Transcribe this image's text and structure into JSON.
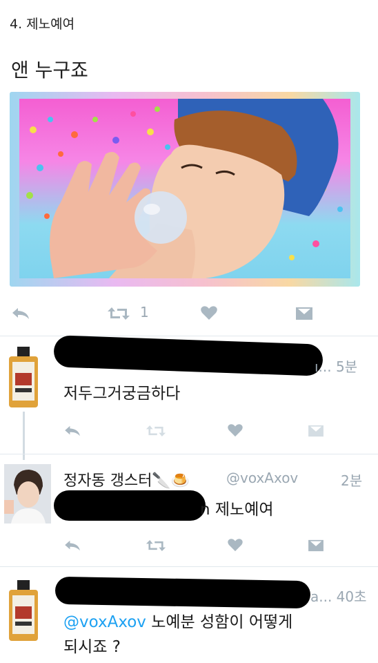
{
  "header": {
    "title": "4. 제노예여"
  },
  "tweet": {
    "text": "앤 누구죠",
    "retweet_count": "1"
  },
  "replies": [
    {
      "time": "ı... 5분",
      "text": "저두그거궁금하다"
    },
    {
      "name": "정자동 갱스터🔪🍮",
      "handle": "@voxAxov",
      "time": "2분",
      "text_tail": "n 제노예여"
    },
    {
      "time": "a... 40초",
      "mention": "@voxAxov",
      "text_line1": " 노예분 성함이 어떻게",
      "text_line2": "되시죠 ?"
    }
  ],
  "colors": {
    "icon_gray": "#aab8c2",
    "mention_blue": "#1da1f2",
    "divider": "#e1e8ed"
  },
  "icons": [
    "reply-icon",
    "retweet-icon",
    "like-icon",
    "dm-icon"
  ]
}
